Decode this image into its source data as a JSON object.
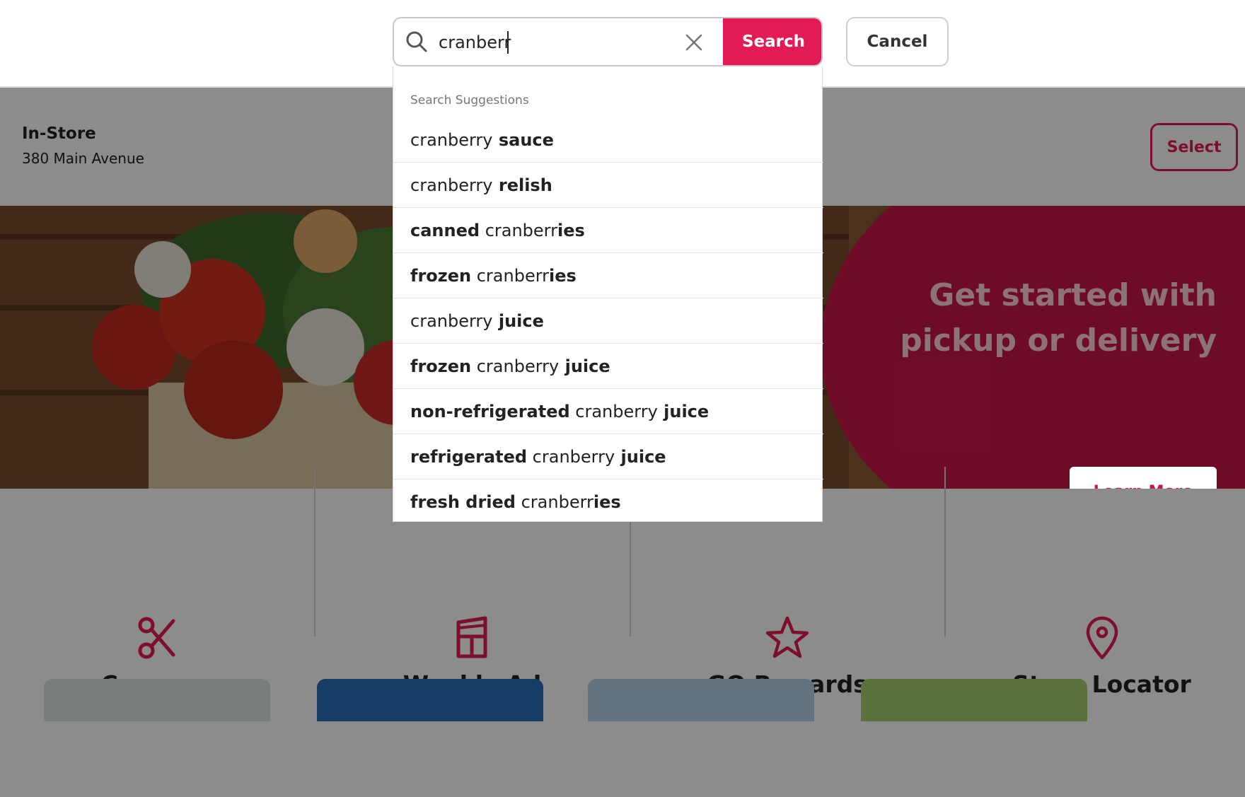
{
  "search": {
    "value": "cranberr",
    "search_label": "Search",
    "cancel_label": "Cancel"
  },
  "store": {
    "type": "In-Store",
    "address": "380 Main Avenue",
    "select_label": "Select"
  },
  "hero": {
    "title_line1": "Get started with",
    "title_line2": "pickup or delivery",
    "cta_label": "Learn More"
  },
  "suggestions": {
    "header": "Search Suggestions",
    "items": [
      {
        "parts": [
          {
            "text": "cranberry",
            "bold": false
          },
          {
            "text": " sauce",
            "bold": true
          }
        ]
      },
      {
        "parts": [
          {
            "text": "cranberry",
            "bold": false
          },
          {
            "text": " relish",
            "bold": true
          }
        ]
      },
      {
        "parts": [
          {
            "text": "canned",
            "bold": true
          },
          {
            "text": " cranberr",
            "bold": false
          },
          {
            "text": "ies",
            "bold": true
          }
        ]
      },
      {
        "parts": [
          {
            "text": "frozen",
            "bold": true
          },
          {
            "text": " cranberr",
            "bold": false
          },
          {
            "text": "ies",
            "bold": true
          }
        ]
      },
      {
        "parts": [
          {
            "text": "cranberry",
            "bold": false
          },
          {
            "text": " juice",
            "bold": true
          }
        ]
      },
      {
        "parts": [
          {
            "text": "frozen",
            "bold": true
          },
          {
            "text": " cranberry",
            "bold": false
          },
          {
            "text": " juice",
            "bold": true
          }
        ]
      },
      {
        "parts": [
          {
            "text": "non-refrigerated",
            "bold": true
          },
          {
            "text": " cranberry",
            "bold": false
          },
          {
            "text": " juice",
            "bold": true
          }
        ]
      },
      {
        "parts": [
          {
            "text": "refrigerated",
            "bold": true
          },
          {
            "text": " cranberry",
            "bold": false
          },
          {
            "text": " juice",
            "bold": true
          }
        ]
      },
      {
        "parts": [
          {
            "text": "fresh dried",
            "bold": true
          },
          {
            "text": " cranberr",
            "bold": false
          },
          {
            "text": "ies",
            "bold": true
          }
        ]
      }
    ]
  },
  "quick_links": [
    {
      "label": "Coupons",
      "icon": "scissors-icon"
    },
    {
      "label": "Weekly Ad",
      "icon": "weekly-ad-icon"
    },
    {
      "label": "GO Rewards",
      "icon": "star-icon"
    },
    {
      "label": "Store Locator",
      "icon": "map-pin-icon"
    }
  ],
  "colors": {
    "brand": "#e31b54",
    "hero_red": "#c8164a"
  }
}
